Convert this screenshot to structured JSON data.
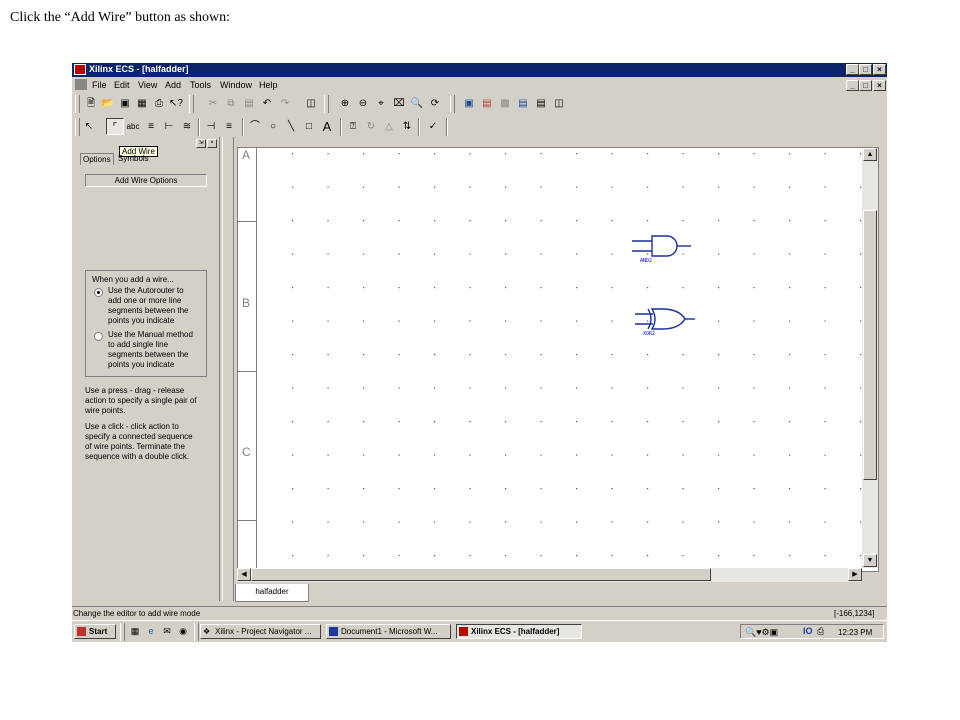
{
  "caption": "Click the “Add Wire” button as shown:",
  "window": {
    "title": "Xilinx ECS - [halfadder]",
    "controls": [
      "_",
      "□",
      "×"
    ]
  },
  "menu": [
    "File",
    "Edit",
    "View",
    "Add",
    "Tools",
    "Window",
    "Help"
  ],
  "tooltip": "Add Wire",
  "panel": {
    "tabs": [
      "Options",
      "Symbols"
    ],
    "header": "Add Wire Options",
    "group_title": "When you add a wire...",
    "radio_options": [
      {
        "lines": [
          "Use the Autorouter to",
          "add one or more line",
          "segments between the",
          "points you indicate"
        ],
        "checked": true
      },
      {
        "lines": [
          "Use the Manual method",
          "to add single line",
          "segments between the",
          "points you indicate"
        ],
        "checked": false
      }
    ],
    "help1": [
      "Use a press - drag - release",
      "action to specify a single pair of",
      "wire points."
    ],
    "help2": [
      "Use a click - click action to",
      "specify a connected sequence",
      "of wire points.  Terminate the",
      "sequence with a double click."
    ]
  },
  "canvas": {
    "zones": [
      "A",
      "B",
      "C"
    ],
    "gates": [
      {
        "type": "AND2",
        "label": "AND2"
      },
      {
        "type": "XOR2",
        "label": "XOR2"
      }
    ]
  },
  "doc_tab": "halfadder",
  "status": {
    "message": "Change the editor to add wire mode",
    "coords": "[-166,1234]"
  },
  "taskbar": {
    "start": "Start",
    "tasks": [
      {
        "label": "Xilinx - Project Navigator ...",
        "active": false
      },
      {
        "label": "Document1 - Microsoft W...",
        "active": false
      },
      {
        "label": "Xilinx ECS - [halfadder]",
        "active": true
      }
    ],
    "clock": "12:23 PM"
  }
}
